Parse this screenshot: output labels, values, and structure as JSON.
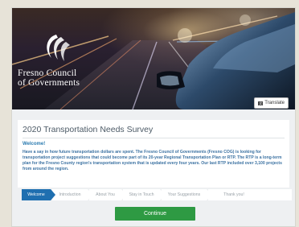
{
  "header": {
    "org_name_line1": "Fresno Council",
    "org_name_line2": "of Governments",
    "translate_label": "Translate"
  },
  "survey": {
    "title": "2020 Transportation Needs Survey",
    "welcome_heading": "Welcome!",
    "intro_text": "Have a say in how future transportation dollars are spent.  The Fresno Council of Governments (Fresno COG) is looking for transportation project suggestions that could become part of its 20-year Regional Transportation Plan or RTP.  The RTP is a long-term plan for the Fresno County region's transportation system that is updated every four years. Our last RTP included over 3,100 projects from around the region."
  },
  "steps": [
    {
      "label": "Welcome",
      "active": true
    },
    {
      "label": "Introduction",
      "active": false
    },
    {
      "label": "About You",
      "active": false
    },
    {
      "label": "Stay in Touch",
      "active": false
    },
    {
      "label": "Your Suggestions",
      "active": false
    },
    {
      "label": "Thank you!",
      "active": false
    }
  ],
  "actions": {
    "continue_label": "Continue"
  },
  "colors": {
    "primary_blue": "#1f6fb0",
    "continue_green": "#2e9a43",
    "text_blue": "#3c72a2"
  }
}
